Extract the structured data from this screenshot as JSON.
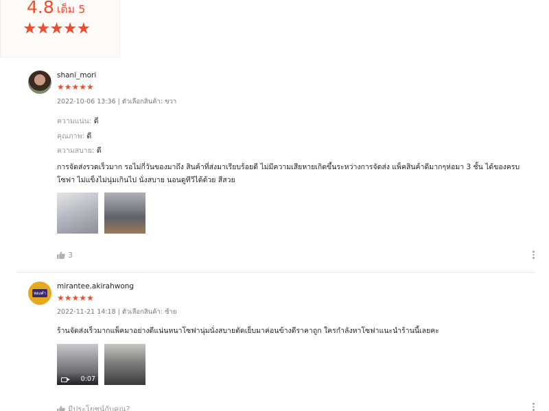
{
  "summary": {
    "score": "4.8",
    "out_of": "เต็ม 5",
    "stars": "★★★★★"
  },
  "reviews": [
    {
      "username": "shani_mori",
      "stars": "★★★★★",
      "rating": 5,
      "meta": "2022-10-06 13:36 | ตัวเลือกสินค้า: ขวา",
      "attributes": [
        {
          "label": "ความแน่น:",
          "value": "ดี"
        },
        {
          "label": "คุณภาพ:",
          "value": "ดี"
        },
        {
          "label": "ความสบาย:",
          "value": "ดี"
        }
      ],
      "comment": "การจัดส่งรวดเร็วมาก รอไม่กี่วันของมาถึง สินค้าที่ส่งมาเรียบร้อยดี ไม่มีความเสียหายเกิดขึ้นระหว่างการจัดส่ง แพ็คสินค้าดีมากๆห่อมา 3 ชั้น ได้ของครบ โซฟา ไม่แข็งไม่นุ่มเกินไป นั่งสบาย นอนดูทีวีได้ด้วย สีสวย",
      "likes": "3"
    },
    {
      "username": "mirantee.akirahwong",
      "stars": "★★★★★",
      "rating": 5,
      "meta": "2022-11-21 14:18 | ตัวเลือกสินค้า: ซ้าย",
      "comment": "ร้านจัดส่งเร็วมากแพ็คมาอย่างดีแน่นหนาโซฟานุ่มนั่งสบายตัดเย็บมาค่อนข้างดีราคาถูก ใครกำลังหาโซฟาแนะนำร้านนี้เลยคะ",
      "video_duration": "0:07",
      "helpful": "มีประโยชน์กับคุณ?",
      "avatar_text": "ทองคำ"
    }
  ],
  "colors": {
    "accent": "#ee4d2d"
  },
  "icons": [
    "star-icon",
    "thumbs-up-icon",
    "more-vertical-icon",
    "video-camera-icon"
  ]
}
